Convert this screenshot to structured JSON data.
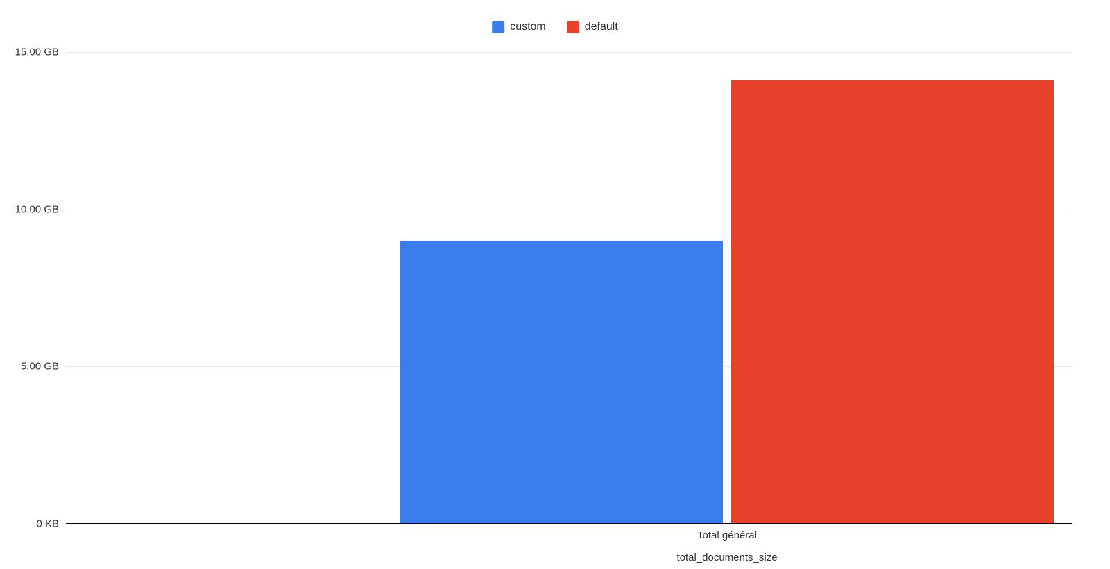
{
  "chart_data": {
    "type": "bar",
    "categories": [
      "Total général"
    ],
    "series": [
      {
        "name": "custom",
        "values": [
          9.0
        ],
        "color": "#3b7ded"
      },
      {
        "name": "default",
        "values": [
          14.1
        ],
        "color": "#e7412c"
      }
    ],
    "xlabel": "total_documents_size",
    "ylabel": "",
    "ylim": [
      0,
      15
    ],
    "ytick_values": [
      0,
      5,
      10,
      15
    ],
    "ytick_labels": [
      "0 KB",
      "5,00 GB",
      "10,00 GB",
      "15,00 GB"
    ],
    "y_unit": "GB"
  },
  "legend": {
    "items": [
      {
        "label": "custom",
        "color": "#3b7ded"
      },
      {
        "label": "default",
        "color": "#e7412c"
      }
    ]
  }
}
